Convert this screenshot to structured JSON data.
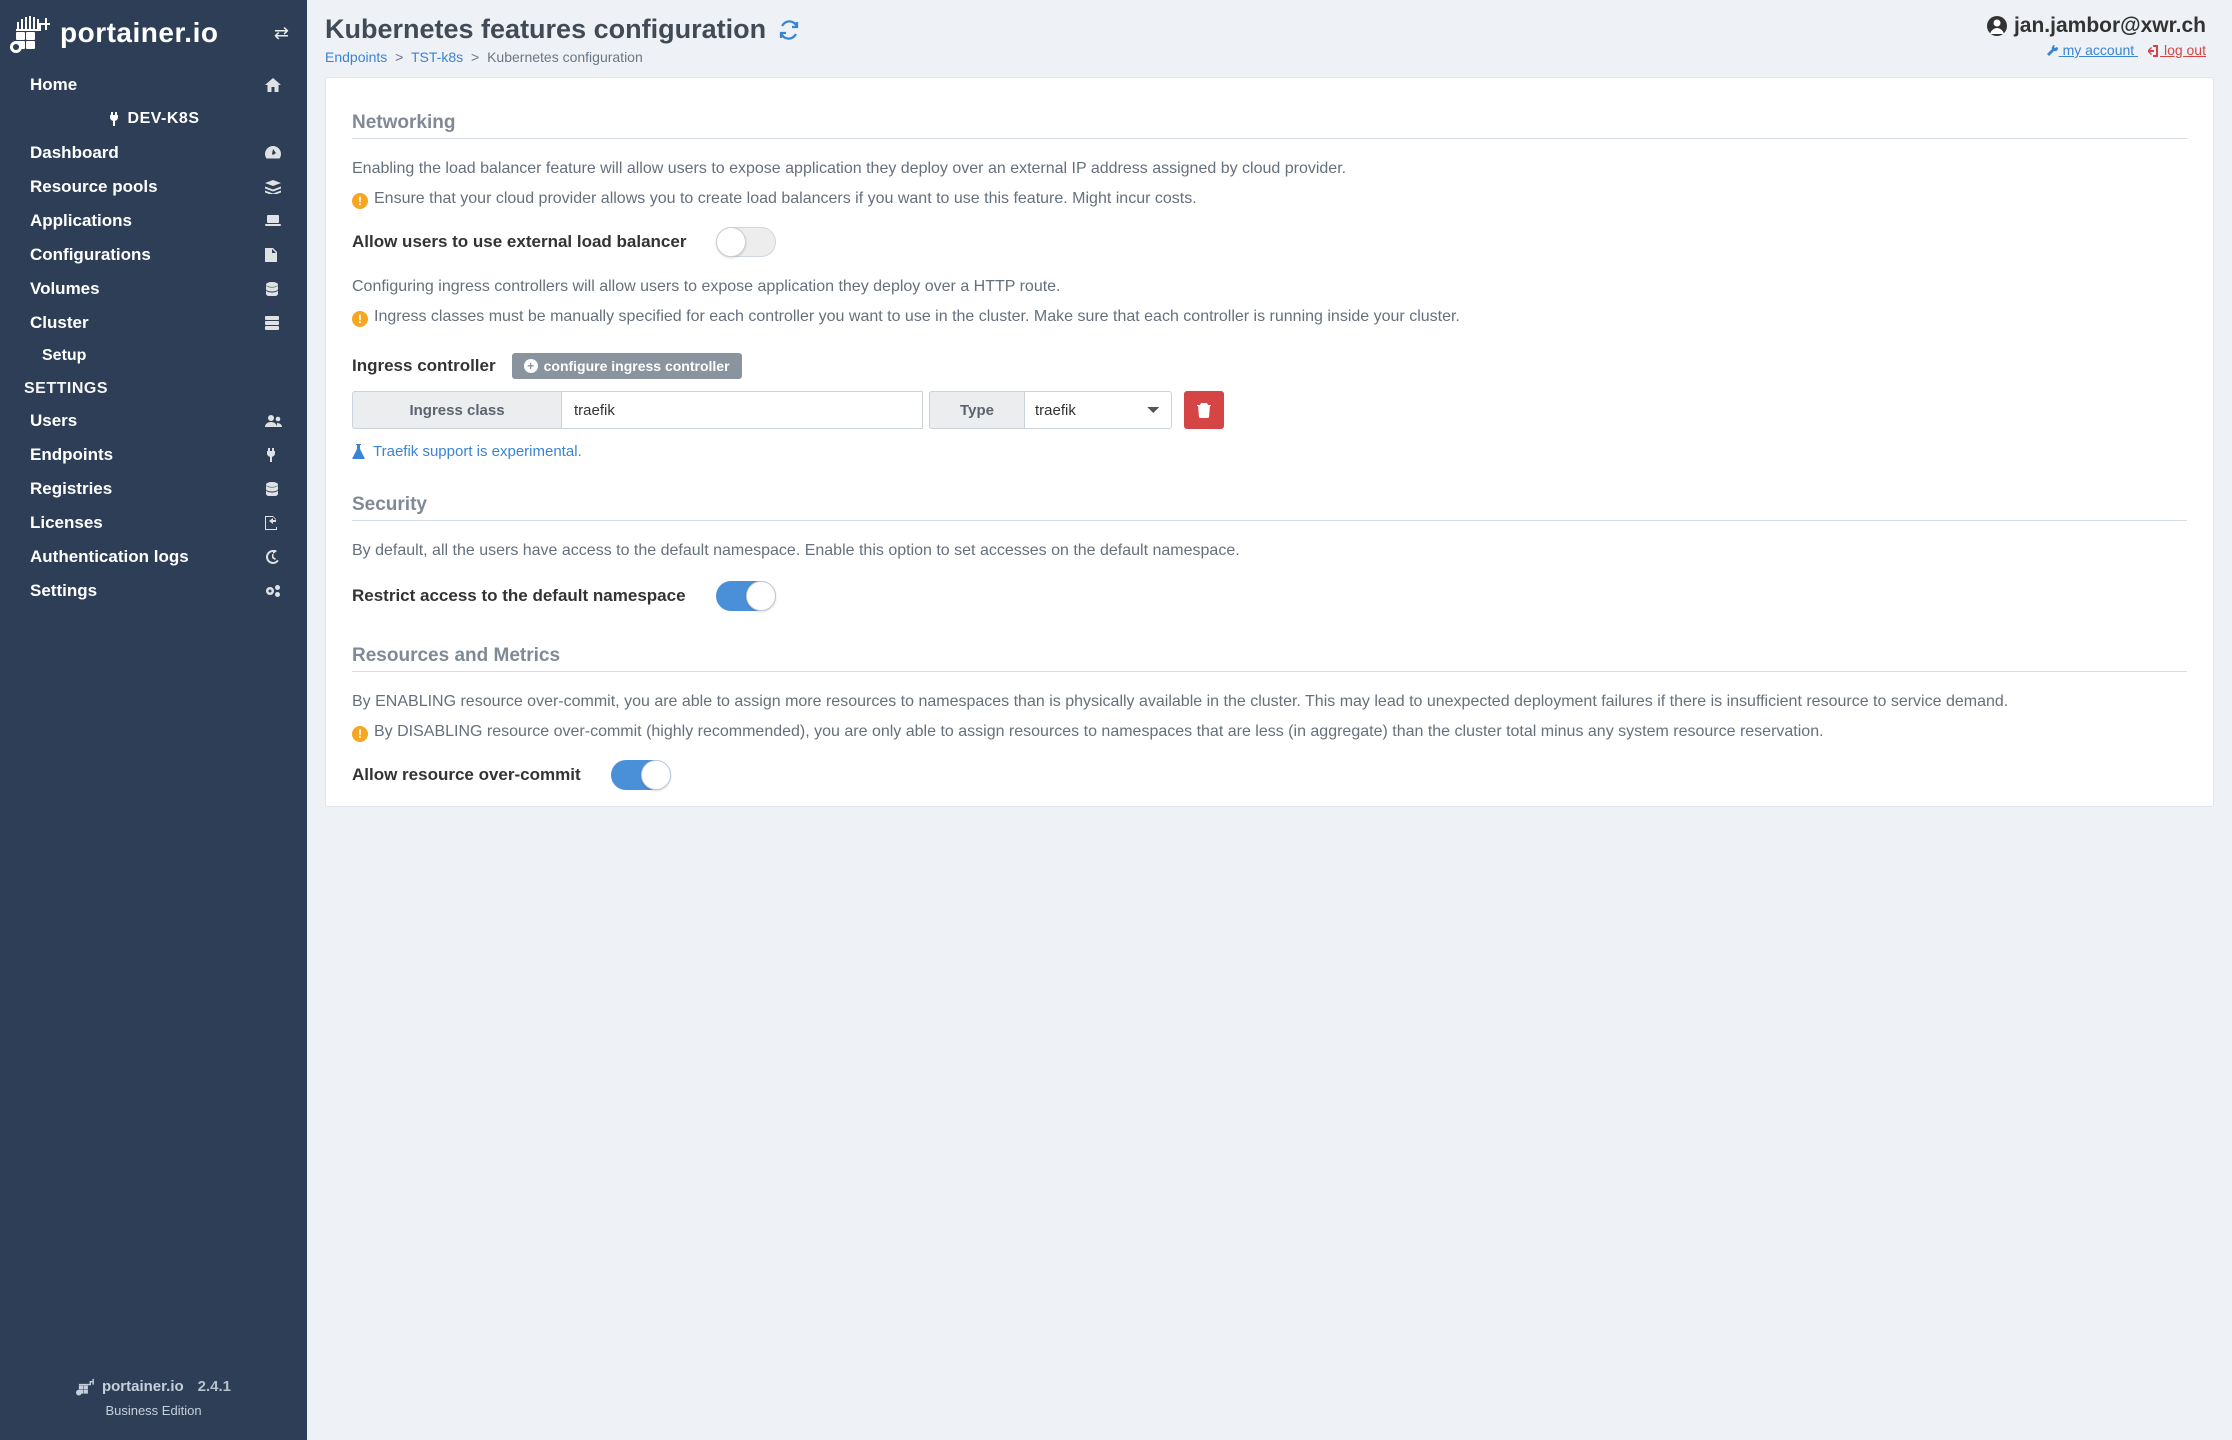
{
  "brand": "portainer.io",
  "header": {
    "title": "Kubernetes features configuration",
    "breadcrumbs": {
      "endpoints": "Endpoints",
      "env": "TST-k8s",
      "current": "Kubernetes configuration"
    },
    "user": "jan.jambor@xwr.ch",
    "links": {
      "account": "my account",
      "logout": "log out"
    }
  },
  "sidebar": {
    "home": "Home",
    "env": "DEV-K8S",
    "items": [
      {
        "label": "Dashboard"
      },
      {
        "label": "Resource pools"
      },
      {
        "label": "Applications"
      },
      {
        "label": "Configurations"
      },
      {
        "label": "Volumes"
      },
      {
        "label": "Cluster"
      }
    ],
    "cluster_sub": "Setup",
    "settings_header": "SETTINGS",
    "settings": [
      {
        "label": "Users"
      },
      {
        "label": "Endpoints"
      },
      {
        "label": "Registries"
      },
      {
        "label": "Licenses"
      },
      {
        "label": "Authentication logs"
      },
      {
        "label": "Settings"
      }
    ],
    "footer": {
      "brand": "portainer.io",
      "version": "2.4.1",
      "edition": "Business Edition"
    }
  },
  "networking": {
    "heading": "Networking",
    "lb_desc": "Enabling the load balancer feature will allow users to expose application they deploy over an external IP address assigned by cloud provider.",
    "lb_warn": "Ensure that your cloud provider allows you to create load balancers if you want to use this feature. Might incur costs.",
    "lb_toggle_label": "Allow users to use external load balancer",
    "ingress_desc": "Configuring ingress controllers will allow users to expose application they deploy over a HTTP route.",
    "ingress_warn": "Ingress classes must be manually specified for each controller you want to use in the cluster. Make sure that each controller is running inside your cluster.",
    "ic_label": "Ingress controller",
    "ic_button": "configure ingress controller",
    "ic_class_header": "Ingress class",
    "ic_class_value": "traefik",
    "ic_type_header": "Type",
    "ic_type_value": "traefik",
    "ic_note": "Traefik support is experimental."
  },
  "security": {
    "heading": "Security",
    "desc": "By default, all the users have access to the default namespace. Enable this option to set accesses on the default namespace.",
    "toggle_label": "Restrict access to the default namespace"
  },
  "resources": {
    "heading": "Resources and Metrics",
    "desc": "By ENABLING resource over-commit, you are able to assign more resources to namespaces than is physically available in the cluster. This may lead to unexpected deployment failures if there is insufficient resource to service demand.",
    "warn": "By DISABLING resource over-commit (highly recommended), you are only able to assign resources to namespaces that are less (in aggregate) than the cluster total minus any system resource reservation.",
    "toggle_label": "Allow resource over-commit"
  }
}
